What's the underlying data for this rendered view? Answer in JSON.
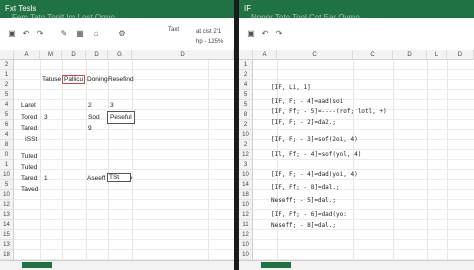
{
  "left": {
    "title": "Fxt Tesls",
    "ghost_title": "Fem Tato Tonlt Im Lost Ormo",
    "ribbon": {
      "label_a": "Taxt",
      "label_b": "at cist 2'1",
      "label_c": "hp - 125%"
    },
    "col_headers": [
      "A",
      "M",
      "D",
      "D",
      "G",
      "D"
    ],
    "row_headers": [
      "2",
      "1",
      "2",
      "5",
      "4",
      "5",
      "6",
      "4",
      "8",
      "0",
      "1",
      "10",
      "5",
      "10",
      "12",
      "13",
      "14",
      "15",
      "13",
      "18"
    ],
    "cells": {
      "r1_m": "Tatuse",
      "r1_d": "Pallicu",
      "r1_e": "Doning",
      "r1_g": "Resefind",
      "r4_a": "Laret",
      "r4_e": "2",
      "r4_g": "3",
      "r5_a": "Tored",
      "r5_m": "3",
      "r5_e": "Sod",
      "r5_g": "Peseful",
      "r6_a": "Tared",
      "r6_e": "9",
      "r7_a": "ISSt",
      "r9_a": "Tuted",
      "r10_a": "Tuted",
      "r11_a": "Tared",
      "r11_m": "1",
      "r11_e": "Aseeff",
      "r11_f": "TSt",
      "r12_a": "Taved"
    }
  },
  "right": {
    "title": "IF",
    "ghost_title": "Nonor Toto Tool Cot Ear Ovmo",
    "col_headers": [
      "A",
      "C",
      "C",
      "D",
      "L",
      "D"
    ],
    "row_headers": [
      "1",
      "2",
      "4",
      "5",
      "5",
      "8",
      "2",
      "10",
      "2",
      "12",
      "3",
      "10",
      "14",
      "18",
      "10",
      "12",
      "11",
      "12",
      "10",
      "10",
      "15"
    ],
    "code": [
      "[IF, Li, 1]",
      "[IF, F; - 4]=aad(soi",
      "[IF, Ff; - 5]=----(rof; lotl, +)",
      "[IF, F; - 2]=da2.;",
      "[IF, F; - 3]=sof(2oi, 4)",
      "[Il, Ff; - 4]=sof(yol, 4)",
      "[IF, F; - 4]=dad(yoi, 4)",
      "[IF, Ff; - 8]=dal.;",
      "Neseff; - 5]=dal.;",
      "[IF, Ff; - 6]=dad(yo:",
      "Neseff; - 8]=dal.;"
    ]
  },
  "colors": {
    "accent": "#207245"
  },
  "icons": [
    "save-icon",
    "undo-icon",
    "redo-icon",
    "paste-icon",
    "bold-icon",
    "italic-icon",
    "format-icon",
    "chevron-right-icon"
  ]
}
